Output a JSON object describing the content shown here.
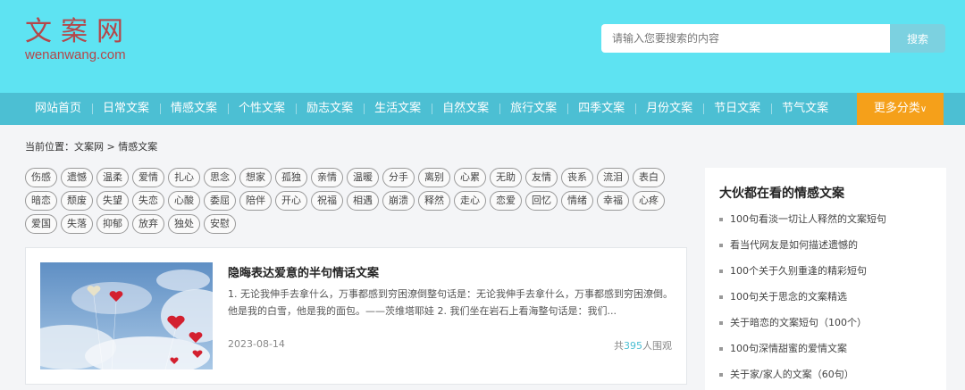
{
  "site": {
    "logo_cn": "文案网",
    "logo_en": "wenanwang.com"
  },
  "search": {
    "placeholder": "请输入您要搜索的内容",
    "button_label": "搜索"
  },
  "nav": {
    "items": [
      "网站首页",
      "日常文案",
      "情感文案",
      "个性文案",
      "励志文案",
      "生活文案",
      "自然文案",
      "旅行文案",
      "四季文案",
      "月份文案",
      "节日文案",
      "节气文案"
    ],
    "more_label": "更多分类",
    "more_icon": "chevron-down-icon"
  },
  "breadcrumb": {
    "text": "当前位置：文案网 > 情感文案"
  },
  "tags": [
    "伤感",
    "遗憾",
    "温柔",
    "爱情",
    "扎心",
    "思念",
    "想家",
    "孤独",
    "亲情",
    "温暖",
    "分手",
    "离别",
    "心累",
    "无助",
    "友情",
    "丧系",
    "流泪",
    "表白",
    "暗恋",
    "颓废",
    "失望",
    "失恋",
    "心酸",
    "委屈",
    "陪伴",
    "开心",
    "祝福",
    "相遇",
    "崩溃",
    "释然",
    "走心",
    "恋爱",
    "回忆",
    "情绪",
    "幸福",
    "心疼",
    "爱国",
    "失落",
    "抑郁",
    "放弃",
    "独处",
    "安慰"
  ],
  "article": {
    "title": "隐晦表达爱意的半句情话文案",
    "summary": "1. 无论我伸手去拿什么，万事都感到穷困潦倒整句话是：无论我伸手去拿什么，万事都感到穷困潦倒。他是我的白雪，他是我的面包。——茨维塔耶娃 2. 我们坐在岩石上看海整句话是：我们...",
    "date": "2023-08-14",
    "views_prefix": "共",
    "views_count": "395",
    "views_suffix": "人围观",
    "image_alt": "sky-with-heart-balloons"
  },
  "sidebar": {
    "title": "大伙都在看的情感文案",
    "items": [
      "100句看淡一切让人释然的文案短句",
      "看当代网友是如何描述遗憾的",
      "100个关于久别重逢的精彩短句",
      "100句关于思念的文案精选",
      "关于暗恋的文案短句（100个）",
      "100句深情甜蜜的爱情文案",
      "关于家/家人的文案（60句）"
    ]
  },
  "colors": {
    "header_bg": "#5ee3f2",
    "nav_bg": "#4cbfd3",
    "more_bg": "#f5a01a",
    "logo": "#b4474a"
  }
}
